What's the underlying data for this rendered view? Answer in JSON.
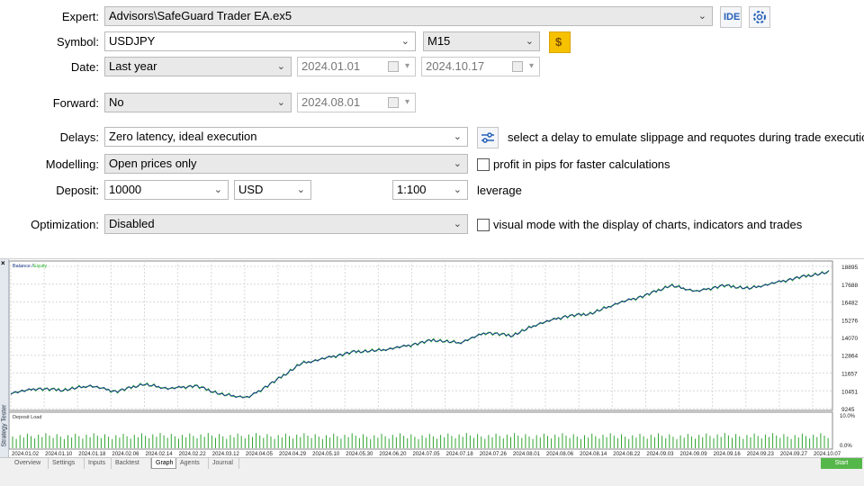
{
  "form": {
    "expert": {
      "label": "Expert:",
      "value": "Advisors\\SafeGuard Trader EA.ex5",
      "ide_label": "IDE"
    },
    "symbol": {
      "label": "Symbol:",
      "value": "USDJPY",
      "timeframe": "M15"
    },
    "date": {
      "label": "Date:",
      "range": "Last year",
      "from": "2024.01.01",
      "to": "2024.10.17"
    },
    "forward": {
      "label": "Forward:",
      "value": "No",
      "date": "2024.08.01"
    },
    "delays": {
      "label": "Delays:",
      "value": "Zero latency, ideal execution",
      "note": "select a delay to emulate slippage and requotes during trade execution"
    },
    "modelling": {
      "label": "Modelling:",
      "value": "Open prices only",
      "checkbox_label": "profit in pips for faster calculations"
    },
    "deposit": {
      "label": "Deposit:",
      "amount": "10000",
      "currency": "USD",
      "leverage": "1:100",
      "leverage_label": "leverage"
    },
    "optimization": {
      "label": "Optimization:",
      "value": "Disabled",
      "checkbox_label": "visual mode with the display of charts, indicators and trades"
    }
  },
  "tester": {
    "side_title": "Strategy Tester",
    "close_glyph": "×",
    "tabs": [
      "Overview",
      "Settings",
      "Inputs",
      "Backtest",
      "Graph",
      "Agents",
      "Journal"
    ],
    "active_tab": "Graph",
    "start_label": "Start"
  },
  "chart_data": [
    {
      "type": "line",
      "legend": [
        "Balance",
        "Equity"
      ],
      "colors": {
        "balance": "#1a3a8a",
        "equity": "#2fb82f",
        "grid": "#d8d8d8"
      },
      "y_ticks": [
        9245,
        10451,
        11657,
        12864,
        14070,
        15276,
        16482,
        17688,
        18895
      ],
      "ylim": [
        9245,
        18895
      ],
      "x_ticks": [
        "2024.01.02",
        "2024.01.10",
        "2024.01.18",
        "2024.02.06",
        "2024.02.14",
        "2024.02.22",
        "2024.03.12",
        "2024.04.05",
        "2024.04.29",
        "2024.05.10",
        "2024.05.30",
        "2024.06.20",
        "2024.07.05",
        "2024.07.18",
        "2024.07.26",
        "2024.08.01",
        "2024.08.06",
        "2024.08.14",
        "2024.08.22",
        "2024.09.03",
        "2024.09.09",
        "2024.09.16",
        "2024.09.23",
        "2024.09.27",
        "2024.10.07"
      ],
      "x_fraction": [
        0,
        0.04,
        0.08,
        0.12,
        0.16,
        0.2,
        0.24,
        0.26,
        0.29,
        0.33,
        0.38,
        0.42,
        0.46,
        0.51,
        0.55,
        0.59,
        0.63,
        0.67,
        0.72,
        0.76,
        0.8,
        0.84,
        0.88,
        0.92,
        0.96,
        0.99,
        1.0
      ],
      "balance": [
        10300,
        10600,
        10500,
        10800,
        10400,
        10900,
        10600,
        10800,
        10200,
        10000,
        11100,
        12300,
        12700,
        13100,
        13200,
        13500,
        13900,
        13700,
        14400,
        14200,
        15000,
        15500,
        15700,
        16400,
        16900,
        17600,
        17200,
        17600,
        17400,
        17800,
        18200,
        18500
      ]
    },
    {
      "type": "bar",
      "title": "Deposit Load",
      "y_ticks": [
        "10.0%",
        "0.0%"
      ],
      "ylim": [
        0,
        10
      ]
    }
  ]
}
